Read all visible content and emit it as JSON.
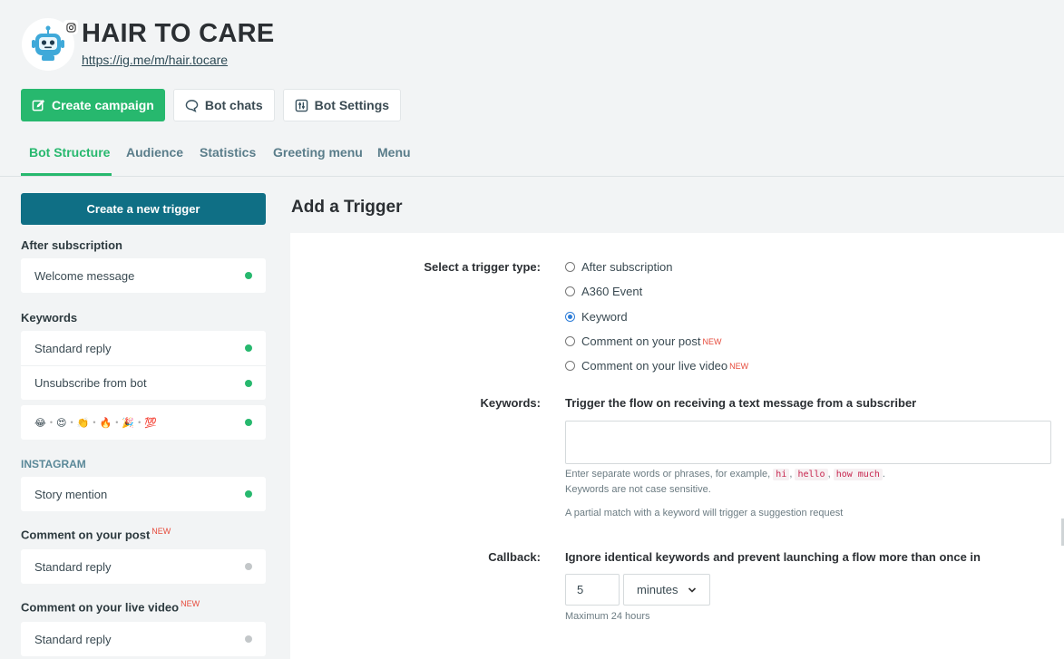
{
  "header": {
    "title": "HAIR TO CARE",
    "link": "https://ig.me/m/hair.tocare"
  },
  "actions": {
    "create_campaign": "Create campaign",
    "bot_chats": "Bot chats",
    "bot_settings": "Bot Settings"
  },
  "tabs": [
    "Bot Structure",
    "Audience",
    "Statistics",
    "Greeting menu",
    "Menu"
  ],
  "sidebar": {
    "create_trigger": "Create a new trigger",
    "after_subscription": {
      "title": "After subscription",
      "items": [
        {
          "label": "Welcome message",
          "status": "active"
        }
      ]
    },
    "keywords": {
      "title": "Keywords",
      "items": [
        {
          "label": "Standard reply",
          "status": "active"
        },
        {
          "label": "Unsubscribe from bot",
          "status": "active"
        }
      ],
      "emoji_item": {
        "emojis": [
          "😂",
          "😍",
          "👏",
          "🔥",
          "🎉",
          "💯"
        ],
        "separator": "•",
        "status": "active"
      }
    },
    "instagram": {
      "title": "INSTAGRAM",
      "items": [
        {
          "label": "Story mention",
          "status": "active"
        }
      ]
    },
    "comment_post": {
      "title": "Comment on your post",
      "badge": "NEW",
      "items": [
        {
          "label": "Standard reply",
          "status": "inactive"
        }
      ]
    },
    "comment_live": {
      "title": "Comment on your live video",
      "badge": "NEW",
      "items": [
        {
          "label": "Standard reply",
          "status": "inactive"
        }
      ]
    }
  },
  "main": {
    "title": "Add a Trigger",
    "trigger_type_label": "Select a trigger type:",
    "trigger_types": [
      {
        "label": "After subscription",
        "checked": false,
        "badge": ""
      },
      {
        "label": "A360 Event",
        "checked": false,
        "badge": ""
      },
      {
        "label": "Keyword",
        "checked": true,
        "badge": ""
      },
      {
        "label": "Comment on your post",
        "checked": false,
        "badge": "NEW"
      },
      {
        "label": "Comment on your live video",
        "checked": false,
        "badge": "NEW"
      }
    ],
    "keywords_label": "Keywords:",
    "keywords_heading": "Trigger the flow on receiving a text message from a subscriber",
    "keywords_value": "",
    "help_line1_prefix": "Enter separate words or phrases, for example,",
    "examples": [
      "hi",
      "hello",
      "how much"
    ],
    "help_line2": "Keywords are not case sensitive.",
    "help_line3": "A partial match with a keyword will trigger a suggestion request",
    "callback_label": "Callback:",
    "callback_heading": "Ignore identical keywords and prevent launching a flow more than once in",
    "callback_value": "5",
    "callback_unit": "minutes",
    "callback_hint": "Maximum 24 hours"
  },
  "colors": {
    "primary_green": "#27b86e",
    "teal_button": "#0f6f85",
    "new_badge": "#e64b3c",
    "radio_checked": "#2f7ed8"
  }
}
